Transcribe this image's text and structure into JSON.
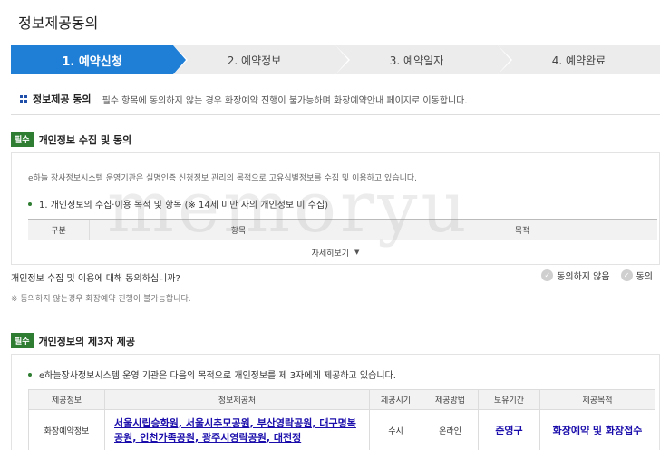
{
  "page": {
    "title": "정보제공동의"
  },
  "steps": [
    {
      "label": "1. 예약신청",
      "active": true
    },
    {
      "label": "2. 예약정보",
      "active": false
    },
    {
      "label": "3. 예약일자",
      "active": false
    },
    {
      "label": "4. 예약완료",
      "active": false
    }
  ],
  "intro": {
    "title": "정보제공 동의",
    "text": "필수 항목에 동의하지 않는 경우 화장예약 진행이 불가능하며 화장예약안내 페이지로 이동합니다."
  },
  "section1": {
    "badge": "필수",
    "title": "개인정보 수집 및 동의",
    "description": "e하늘 장사정보시스템 운영기관은 실명인증 신청정보 관리의 목적으로 고유식별정보를 수집 및 이용하고 있습니다.",
    "item": "1. 개인정보의 수집·이용 목적 및 항목 (※ 14세 미만 자의 개인정보 미 수집)",
    "table_headers": [
      "구분",
      "항목",
      "목적"
    ],
    "more_label": "자세히보기",
    "question": "개인정보 수집 및 이용에 대해 동의하십니까?",
    "options": [
      "동의하지 않음",
      "동의"
    ],
    "note": "※ 동의하지 않는경우 화장예약 진행이 불가능합니다."
  },
  "section2": {
    "badge": "필수",
    "title": "개인정보의 제3자 제공",
    "description": "e하늘장사정보시스템 운영 기관은 다음의 목적으로 개인정보를 제 3자에게 제공하고 있습니다.",
    "table_headers": [
      "제공정보",
      "정보제공처",
      "제공시기",
      "제공방법",
      "보유기간",
      "제공목적"
    ],
    "row": {
      "info": "화장예약정보",
      "provider": "서울시립승화원, 서울시추모공원, 부산영락공원, 대구명복공원, 인천가족공원, 광주시영락공원, 대전정",
      "timing": "수시",
      "method": "온라인",
      "period": "준영구",
      "purpose": "화장예약 및 화장접수"
    }
  },
  "watermark": "memoryu",
  "colors": {
    "accent": "#1f7ed6",
    "badge": "#2e7d32",
    "link": "#1a0dab"
  }
}
